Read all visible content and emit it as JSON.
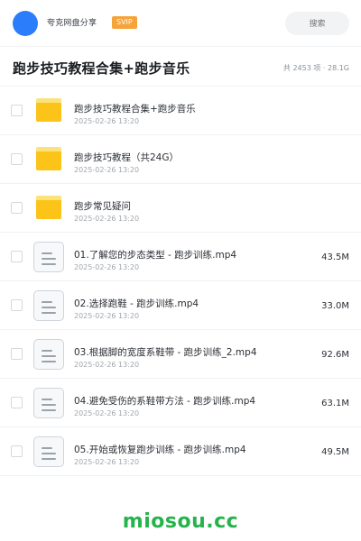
{
  "header": {
    "user_name": "夸克网盘分享",
    "vip_label": "SVIP",
    "search_placeholder": "搜索"
  },
  "title_bar": {
    "title": "跑步技巧教程合集+跑步音乐",
    "summary": "共 2453 项 · 28.1G"
  },
  "items": [
    {
      "type": "folder",
      "name": "跑步技巧教程合集+跑步音乐",
      "date": "2025-02-26 13:20",
      "size": ""
    },
    {
      "type": "folder",
      "name": "跑步技巧教程（共24G）",
      "date": "2025-02-26 13:20",
      "size": ""
    },
    {
      "type": "folder",
      "name": "跑步常见疑问",
      "date": "2025-02-26 13:20",
      "size": ""
    },
    {
      "type": "file",
      "name": "01.了解您的步态类型 - 跑步训练.mp4",
      "date": "2025-02-26 13:20",
      "size": "43.5M"
    },
    {
      "type": "file",
      "name": "02.选择跑鞋 - 跑步训练.mp4",
      "date": "2025-02-26 13:20",
      "size": "33.0M"
    },
    {
      "type": "file",
      "name": "03.根据脚的宽度系鞋带 - 跑步训练_2.mp4",
      "date": "2025-02-26 13:20",
      "size": "92.6M"
    },
    {
      "type": "file",
      "name": "04.避免受伤的系鞋带方法 - 跑步训练.mp4",
      "date": "2025-02-26 13:20",
      "size": "63.1M"
    },
    {
      "type": "file",
      "name": "05.开始或恢复跑步训练 - 跑步训练.mp4",
      "date": "2025-02-26 13:20",
      "size": "49.5M"
    }
  ],
  "watermark": "miosou.cc",
  "colors": {
    "avatar": "#2b7dfb",
    "vip": "#f6a43a",
    "folder": "#fcc419",
    "watermark": "#25b34b"
  }
}
